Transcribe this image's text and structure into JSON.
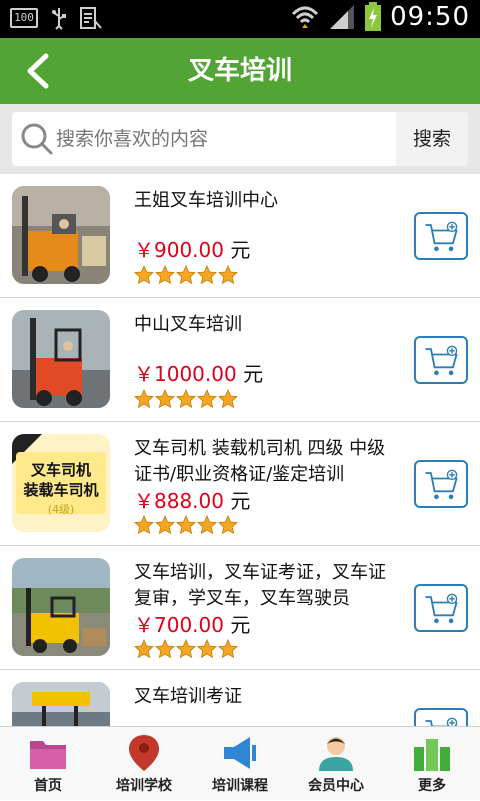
{
  "status_bar": {
    "battery_percent": "100",
    "time": "09:50"
  },
  "header": {
    "title": "叉车培训"
  },
  "search": {
    "placeholder": "搜索你喜欢的内容",
    "button_label": "搜索"
  },
  "listings": [
    {
      "name": "王姐叉车培训中心",
      "price": "￥900.00",
      "unit": "元",
      "rating": 5
    },
    {
      "name": "中山叉车培训",
      "price": "￥1000.00",
      "unit": "元",
      "rating": 5
    },
    {
      "name": "叉车司机 装载机司机 四级 中级 证书/职业资格证/鉴定培训",
      "price": "￥888.00",
      "unit": "元",
      "rating": 5,
      "thumb_text": [
        "叉车司机",
        "装载车司机",
        "(4级)"
      ]
    },
    {
      "name": "叉车培训，叉车证考证，叉车证复审，学叉车，叉车驾驶员",
      "price": "￥700.00",
      "unit": "元",
      "rating": 5
    },
    {
      "name": "叉车培训考证"
    }
  ],
  "tabs": [
    {
      "label": "首页",
      "icon": "folder-icon"
    },
    {
      "label": "培训学校",
      "icon": "map-pin-icon"
    },
    {
      "label": "培训课程",
      "icon": "megaphone-icon"
    },
    {
      "label": "会员中心",
      "icon": "user-icon"
    },
    {
      "label": "更多",
      "icon": "more-icon"
    }
  ],
  "colors": {
    "header_green": "#52a534",
    "price_red": "#e0001b",
    "cart_blue": "#2a7fb8",
    "star_orange": "#f5a623"
  }
}
